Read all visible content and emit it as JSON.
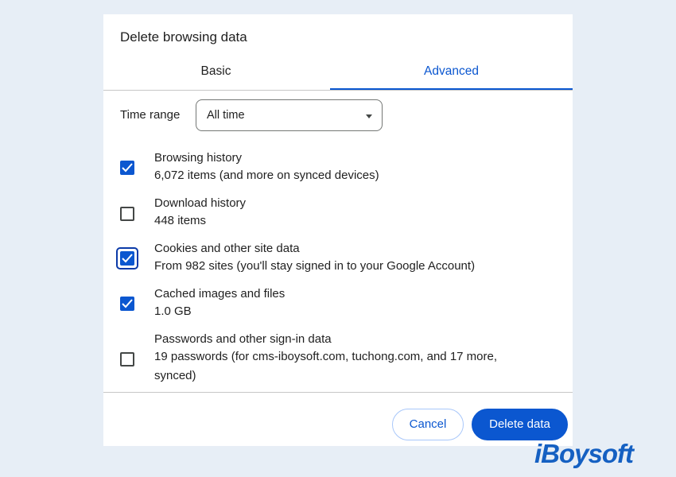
{
  "dialog": {
    "title": "Delete browsing data",
    "tabs": [
      {
        "label": "Basic",
        "active": false
      },
      {
        "label": "Advanced",
        "active": true
      }
    ],
    "time_range": {
      "label": "Time range",
      "selected": "All time"
    },
    "items": [
      {
        "title": "Browsing history",
        "subtitle": "6,072 items (and more on synced devices)",
        "checked": true,
        "focused": false
      },
      {
        "title": "Download history",
        "subtitle": "448 items",
        "checked": false,
        "focused": false
      },
      {
        "title": "Cookies and other site data",
        "subtitle": "From 982 sites (you'll stay signed in to your Google Account)",
        "checked": true,
        "focused": true
      },
      {
        "title": "Cached images and files",
        "subtitle": "1.0 GB",
        "checked": true,
        "focused": false
      },
      {
        "title": "Passwords and other sign-in data",
        "subtitle": "19 passwords (for cms-iboysoft.com, tuchong.com, and 17 more, synced)",
        "checked": false,
        "focused": false
      }
    ],
    "buttons": {
      "cancel_label": "Cancel",
      "delete_label": "Delete data"
    }
  },
  "watermark": "iBoysoft",
  "colors": {
    "accent": "#0b57d0",
    "background": "#e7eef6",
    "watermark": "#1560c2"
  }
}
